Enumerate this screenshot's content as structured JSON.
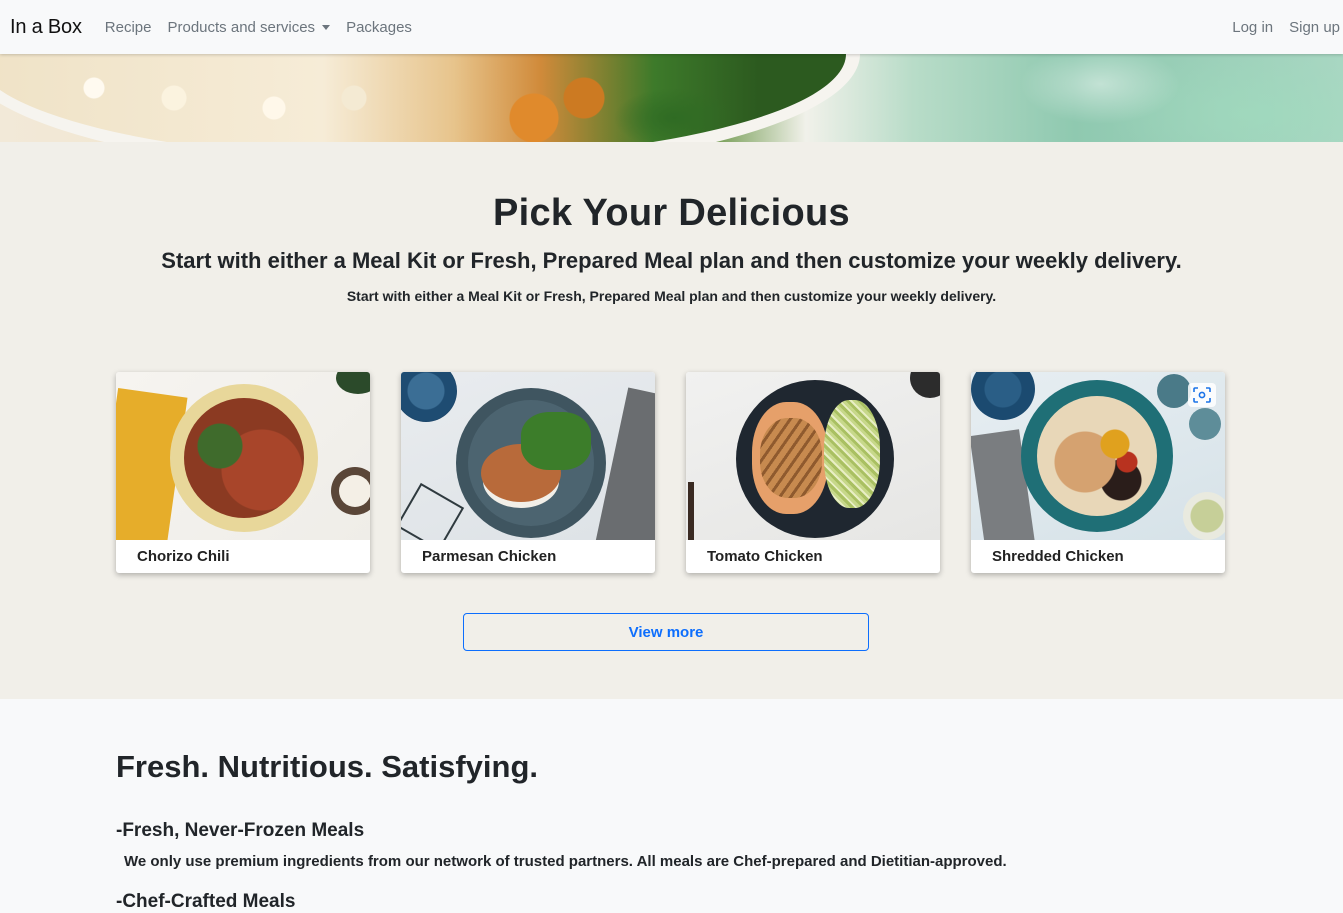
{
  "navbar": {
    "brand": "In a Box",
    "links": [
      "Recipe",
      "Products and services",
      "Packages"
    ],
    "auth": {
      "login": "Log in",
      "signup": "Sign up"
    }
  },
  "pick": {
    "title": "Pick Your Delicious",
    "subtitle": "Start with either a Meal Kit or Fresh, Prepared Meal plan and then customize your weekly delivery.",
    "small": "Start with either a Meal Kit or Fresh, Prepared Meal plan and then customize your weekly delivery.",
    "cards": [
      {
        "label": "Chorizo Chili"
      },
      {
        "label": "Parmesan Chicken"
      },
      {
        "label": "Tomato Chicken"
      },
      {
        "label": "Shredded Chicken"
      }
    ],
    "view_more": "View more"
  },
  "fresh": {
    "title": "Fresh. Nutritious. Satisfying.",
    "features": [
      {
        "title": "-Fresh, Never-Frozen Meals",
        "desc": "We only use premium ingredients from our network of trusted partners. All meals are Chef-prepared and Dietitian-approved."
      },
      {
        "title": "-Chef-Crafted Meals"
      }
    ]
  },
  "colors": {
    "accent": "#0d6efd",
    "pick_bg": "#f1efe9",
    "nav_bg": "#f8f9fa"
  },
  "icons": [
    "caret-down-icon",
    "scan-icon"
  ]
}
